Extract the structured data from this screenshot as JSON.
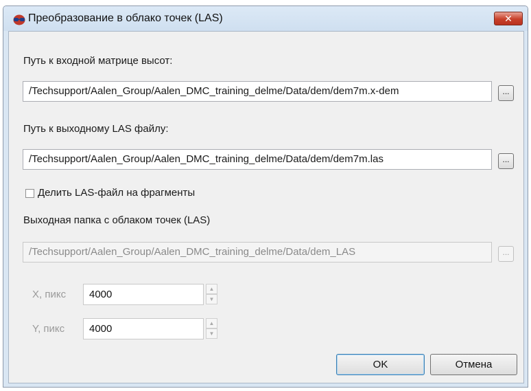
{
  "window": {
    "title": "Преобразование в облако точек (LAS)",
    "close_label": "✕"
  },
  "input_matrix": {
    "label": "Путь к входной матрице высот:",
    "value": "/Techsupport/Aalen_Group/Aalen_DMC_training_delme/Data/dem/dem7m.x-dem",
    "browse_label": "..."
  },
  "output_las": {
    "label": "Путь к выходному LAS файлу:",
    "value": "/Techsupport/Aalen_Group/Aalen_DMC_training_delme/Data/dem/dem7m.las",
    "browse_label": "..."
  },
  "split_checkbox": {
    "label": "Делить LAS-файл на фрагменты",
    "checked": false
  },
  "output_folder": {
    "label": "Выходная папка с облаком точек (LAS)",
    "value": "/Techsupport/Aalen_Group/Aalen_DMC_training_delme/Data/dem_LAS",
    "browse_label": "...",
    "enabled": false
  },
  "fragment_x": {
    "label": "X, пикс",
    "value": "4000"
  },
  "fragment_y": {
    "label": "Y, пикс",
    "value": "4000"
  },
  "buttons": {
    "ok": "OK",
    "cancel": "Отмена"
  },
  "colors": {
    "titlebar": "#d9e6f3",
    "client": "#f0f0f0",
    "close": "#c8402a"
  }
}
